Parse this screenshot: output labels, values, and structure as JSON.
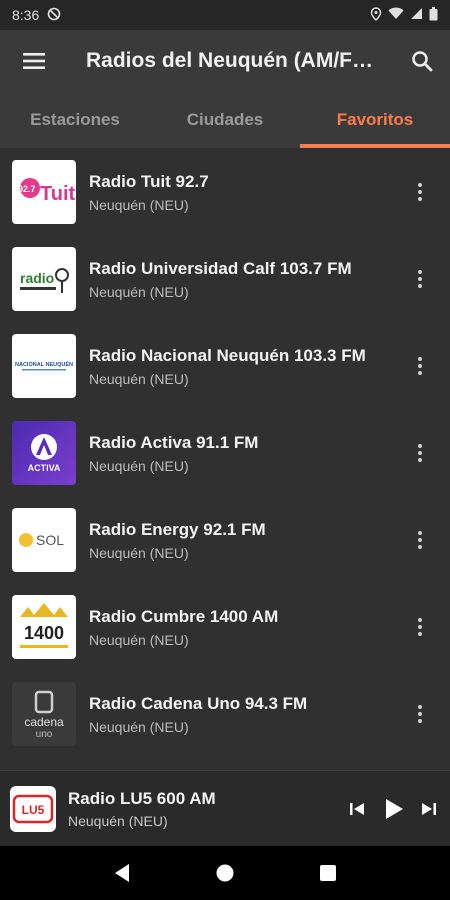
{
  "status": {
    "time": "8:36"
  },
  "app_bar": {
    "title": "Radios del Neuquén (AM/F…"
  },
  "tabs": [
    {
      "label": "Estaciones",
      "active": false
    },
    {
      "label": "Ciudades",
      "active": false
    },
    {
      "label": "Favoritos",
      "active": true
    }
  ],
  "stations": [
    {
      "name": "Radio Tuit 92.7",
      "city": "Neuquén (NEU)",
      "logo_text": "92.7 Tuit"
    },
    {
      "name": "Radio Universidad Calf 103.7 FM",
      "city": "Neuquén (NEU)",
      "logo_text": "radio"
    },
    {
      "name": "Radio Nacional Neuquén 103.3 FM",
      "city": "Neuquén (NEU)",
      "logo_text": "NACIONAL NEUQUÉN"
    },
    {
      "name": "Radio Activa 91.1 FM",
      "city": "Neuquén (NEU)",
      "logo_text": "ACTIVA"
    },
    {
      "name": "Radio Energy 92.1 FM",
      "city": "Neuquén (NEU)",
      "logo_text": "SOL"
    },
    {
      "name": "Radio Cumbre 1400 AM",
      "city": "Neuquén (NEU)",
      "logo_text": "1400"
    },
    {
      "name": "Radio Cadena Uno 94.3 FM",
      "city": "Neuquén (NEU)",
      "logo_text": "cadena uno"
    }
  ],
  "player": {
    "name": "Radio LU5 600 AM",
    "city": "Neuquén (NEU)",
    "logo_text": "LU5"
  },
  "colors": {
    "accent": "#ff7d4d",
    "background": "#303030",
    "appbar": "#3a3a3a"
  }
}
